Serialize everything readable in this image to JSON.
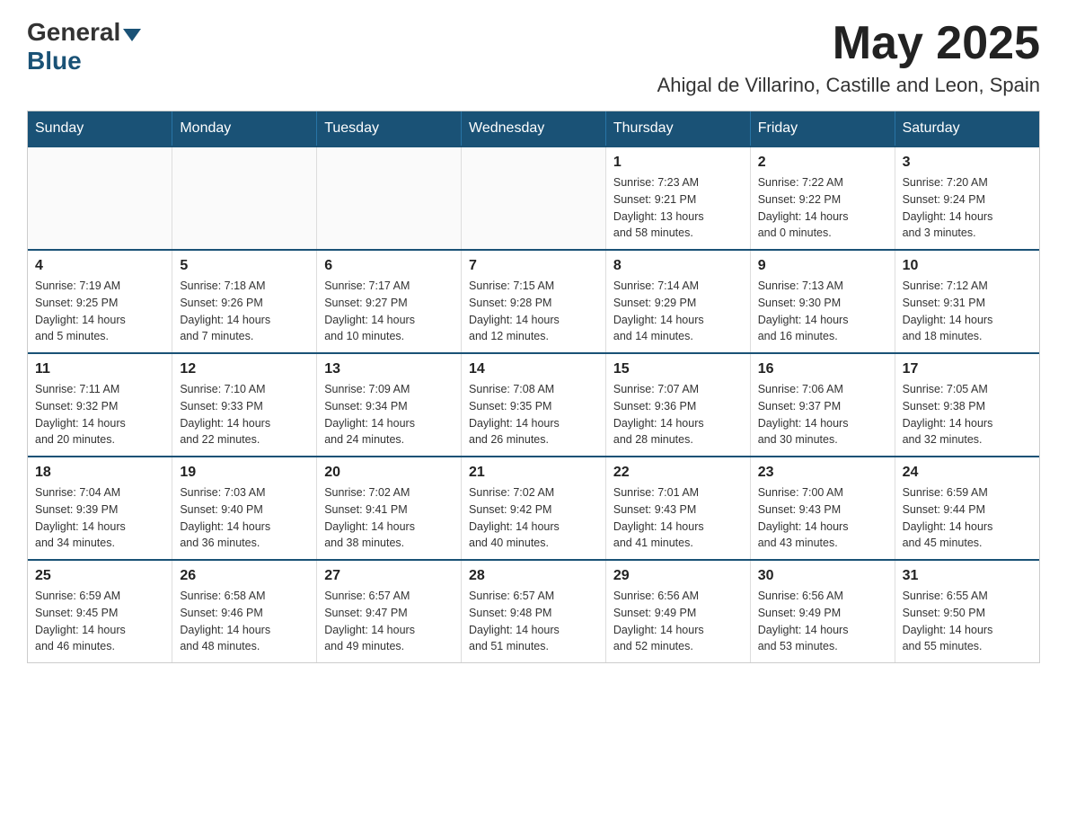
{
  "header": {
    "logo_general": "General",
    "logo_blue": "Blue",
    "month_year": "May 2025",
    "location": "Ahigal de Villarino, Castille and Leon, Spain"
  },
  "days_of_week": [
    "Sunday",
    "Monday",
    "Tuesday",
    "Wednesday",
    "Thursday",
    "Friday",
    "Saturday"
  ],
  "weeks": [
    [
      {
        "day": "",
        "info": ""
      },
      {
        "day": "",
        "info": ""
      },
      {
        "day": "",
        "info": ""
      },
      {
        "day": "",
        "info": ""
      },
      {
        "day": "1",
        "info": "Sunrise: 7:23 AM\nSunset: 9:21 PM\nDaylight: 13 hours\nand 58 minutes."
      },
      {
        "day": "2",
        "info": "Sunrise: 7:22 AM\nSunset: 9:22 PM\nDaylight: 14 hours\nand 0 minutes."
      },
      {
        "day": "3",
        "info": "Sunrise: 7:20 AM\nSunset: 9:24 PM\nDaylight: 14 hours\nand 3 minutes."
      }
    ],
    [
      {
        "day": "4",
        "info": "Sunrise: 7:19 AM\nSunset: 9:25 PM\nDaylight: 14 hours\nand 5 minutes."
      },
      {
        "day": "5",
        "info": "Sunrise: 7:18 AM\nSunset: 9:26 PM\nDaylight: 14 hours\nand 7 minutes."
      },
      {
        "day": "6",
        "info": "Sunrise: 7:17 AM\nSunset: 9:27 PM\nDaylight: 14 hours\nand 10 minutes."
      },
      {
        "day": "7",
        "info": "Sunrise: 7:15 AM\nSunset: 9:28 PM\nDaylight: 14 hours\nand 12 minutes."
      },
      {
        "day": "8",
        "info": "Sunrise: 7:14 AM\nSunset: 9:29 PM\nDaylight: 14 hours\nand 14 minutes."
      },
      {
        "day": "9",
        "info": "Sunrise: 7:13 AM\nSunset: 9:30 PM\nDaylight: 14 hours\nand 16 minutes."
      },
      {
        "day": "10",
        "info": "Sunrise: 7:12 AM\nSunset: 9:31 PM\nDaylight: 14 hours\nand 18 minutes."
      }
    ],
    [
      {
        "day": "11",
        "info": "Sunrise: 7:11 AM\nSunset: 9:32 PM\nDaylight: 14 hours\nand 20 minutes."
      },
      {
        "day": "12",
        "info": "Sunrise: 7:10 AM\nSunset: 9:33 PM\nDaylight: 14 hours\nand 22 minutes."
      },
      {
        "day": "13",
        "info": "Sunrise: 7:09 AM\nSunset: 9:34 PM\nDaylight: 14 hours\nand 24 minutes."
      },
      {
        "day": "14",
        "info": "Sunrise: 7:08 AM\nSunset: 9:35 PM\nDaylight: 14 hours\nand 26 minutes."
      },
      {
        "day": "15",
        "info": "Sunrise: 7:07 AM\nSunset: 9:36 PM\nDaylight: 14 hours\nand 28 minutes."
      },
      {
        "day": "16",
        "info": "Sunrise: 7:06 AM\nSunset: 9:37 PM\nDaylight: 14 hours\nand 30 minutes."
      },
      {
        "day": "17",
        "info": "Sunrise: 7:05 AM\nSunset: 9:38 PM\nDaylight: 14 hours\nand 32 minutes."
      }
    ],
    [
      {
        "day": "18",
        "info": "Sunrise: 7:04 AM\nSunset: 9:39 PM\nDaylight: 14 hours\nand 34 minutes."
      },
      {
        "day": "19",
        "info": "Sunrise: 7:03 AM\nSunset: 9:40 PM\nDaylight: 14 hours\nand 36 minutes."
      },
      {
        "day": "20",
        "info": "Sunrise: 7:02 AM\nSunset: 9:41 PM\nDaylight: 14 hours\nand 38 minutes."
      },
      {
        "day": "21",
        "info": "Sunrise: 7:02 AM\nSunset: 9:42 PM\nDaylight: 14 hours\nand 40 minutes."
      },
      {
        "day": "22",
        "info": "Sunrise: 7:01 AM\nSunset: 9:43 PM\nDaylight: 14 hours\nand 41 minutes."
      },
      {
        "day": "23",
        "info": "Sunrise: 7:00 AM\nSunset: 9:43 PM\nDaylight: 14 hours\nand 43 minutes."
      },
      {
        "day": "24",
        "info": "Sunrise: 6:59 AM\nSunset: 9:44 PM\nDaylight: 14 hours\nand 45 minutes."
      }
    ],
    [
      {
        "day": "25",
        "info": "Sunrise: 6:59 AM\nSunset: 9:45 PM\nDaylight: 14 hours\nand 46 minutes."
      },
      {
        "day": "26",
        "info": "Sunrise: 6:58 AM\nSunset: 9:46 PM\nDaylight: 14 hours\nand 48 minutes."
      },
      {
        "day": "27",
        "info": "Sunrise: 6:57 AM\nSunset: 9:47 PM\nDaylight: 14 hours\nand 49 minutes."
      },
      {
        "day": "28",
        "info": "Sunrise: 6:57 AM\nSunset: 9:48 PM\nDaylight: 14 hours\nand 51 minutes."
      },
      {
        "day": "29",
        "info": "Sunrise: 6:56 AM\nSunset: 9:49 PM\nDaylight: 14 hours\nand 52 minutes."
      },
      {
        "day": "30",
        "info": "Sunrise: 6:56 AM\nSunset: 9:49 PM\nDaylight: 14 hours\nand 53 minutes."
      },
      {
        "day": "31",
        "info": "Sunrise: 6:55 AM\nSunset: 9:50 PM\nDaylight: 14 hours\nand 55 minutes."
      }
    ]
  ]
}
